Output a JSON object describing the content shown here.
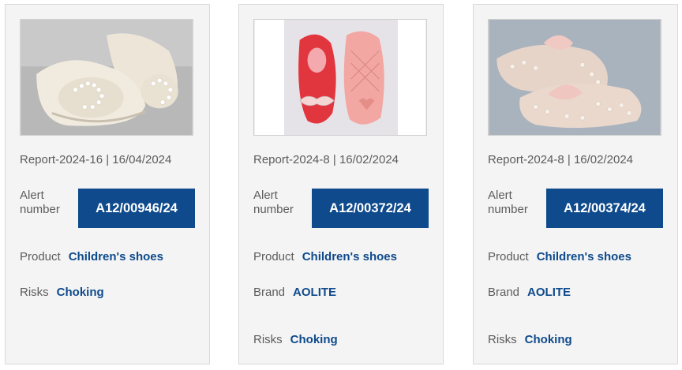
{
  "cards": [
    {
      "report": "Report-2024-16 | 16/04/2024",
      "alert_label_1": "Alert",
      "alert_label_2": "number",
      "alert_number": "A12/00946/24",
      "product_label": "Product",
      "product_value": "Children's shoes",
      "risks_label": "Risks",
      "risks_value": "Choking"
    },
    {
      "report": "Report-2024-8 | 16/02/2024",
      "alert_label_1": "Alert",
      "alert_label_2": "number",
      "alert_number": "A12/00372/24",
      "product_label": "Product",
      "product_value": "Children's shoes",
      "brand_label": "Brand",
      "brand_value": "AOLITE",
      "risks_label": "Risks",
      "risks_value": "Choking"
    },
    {
      "report": "Report-2024-8 | 16/02/2024",
      "alert_label_1": "Alert",
      "alert_label_2": "number",
      "alert_number": "A12/00374/24",
      "product_label": "Product",
      "product_value": "Children's shoes",
      "brand_label": "Brand",
      "brand_value": "AOLITE",
      "risks_label": "Risks",
      "risks_value": "Choking"
    }
  ],
  "colors": {
    "card_bg": "#f4f4f4",
    "accent": "#0e4a8c",
    "label": "#5c5c5c"
  }
}
